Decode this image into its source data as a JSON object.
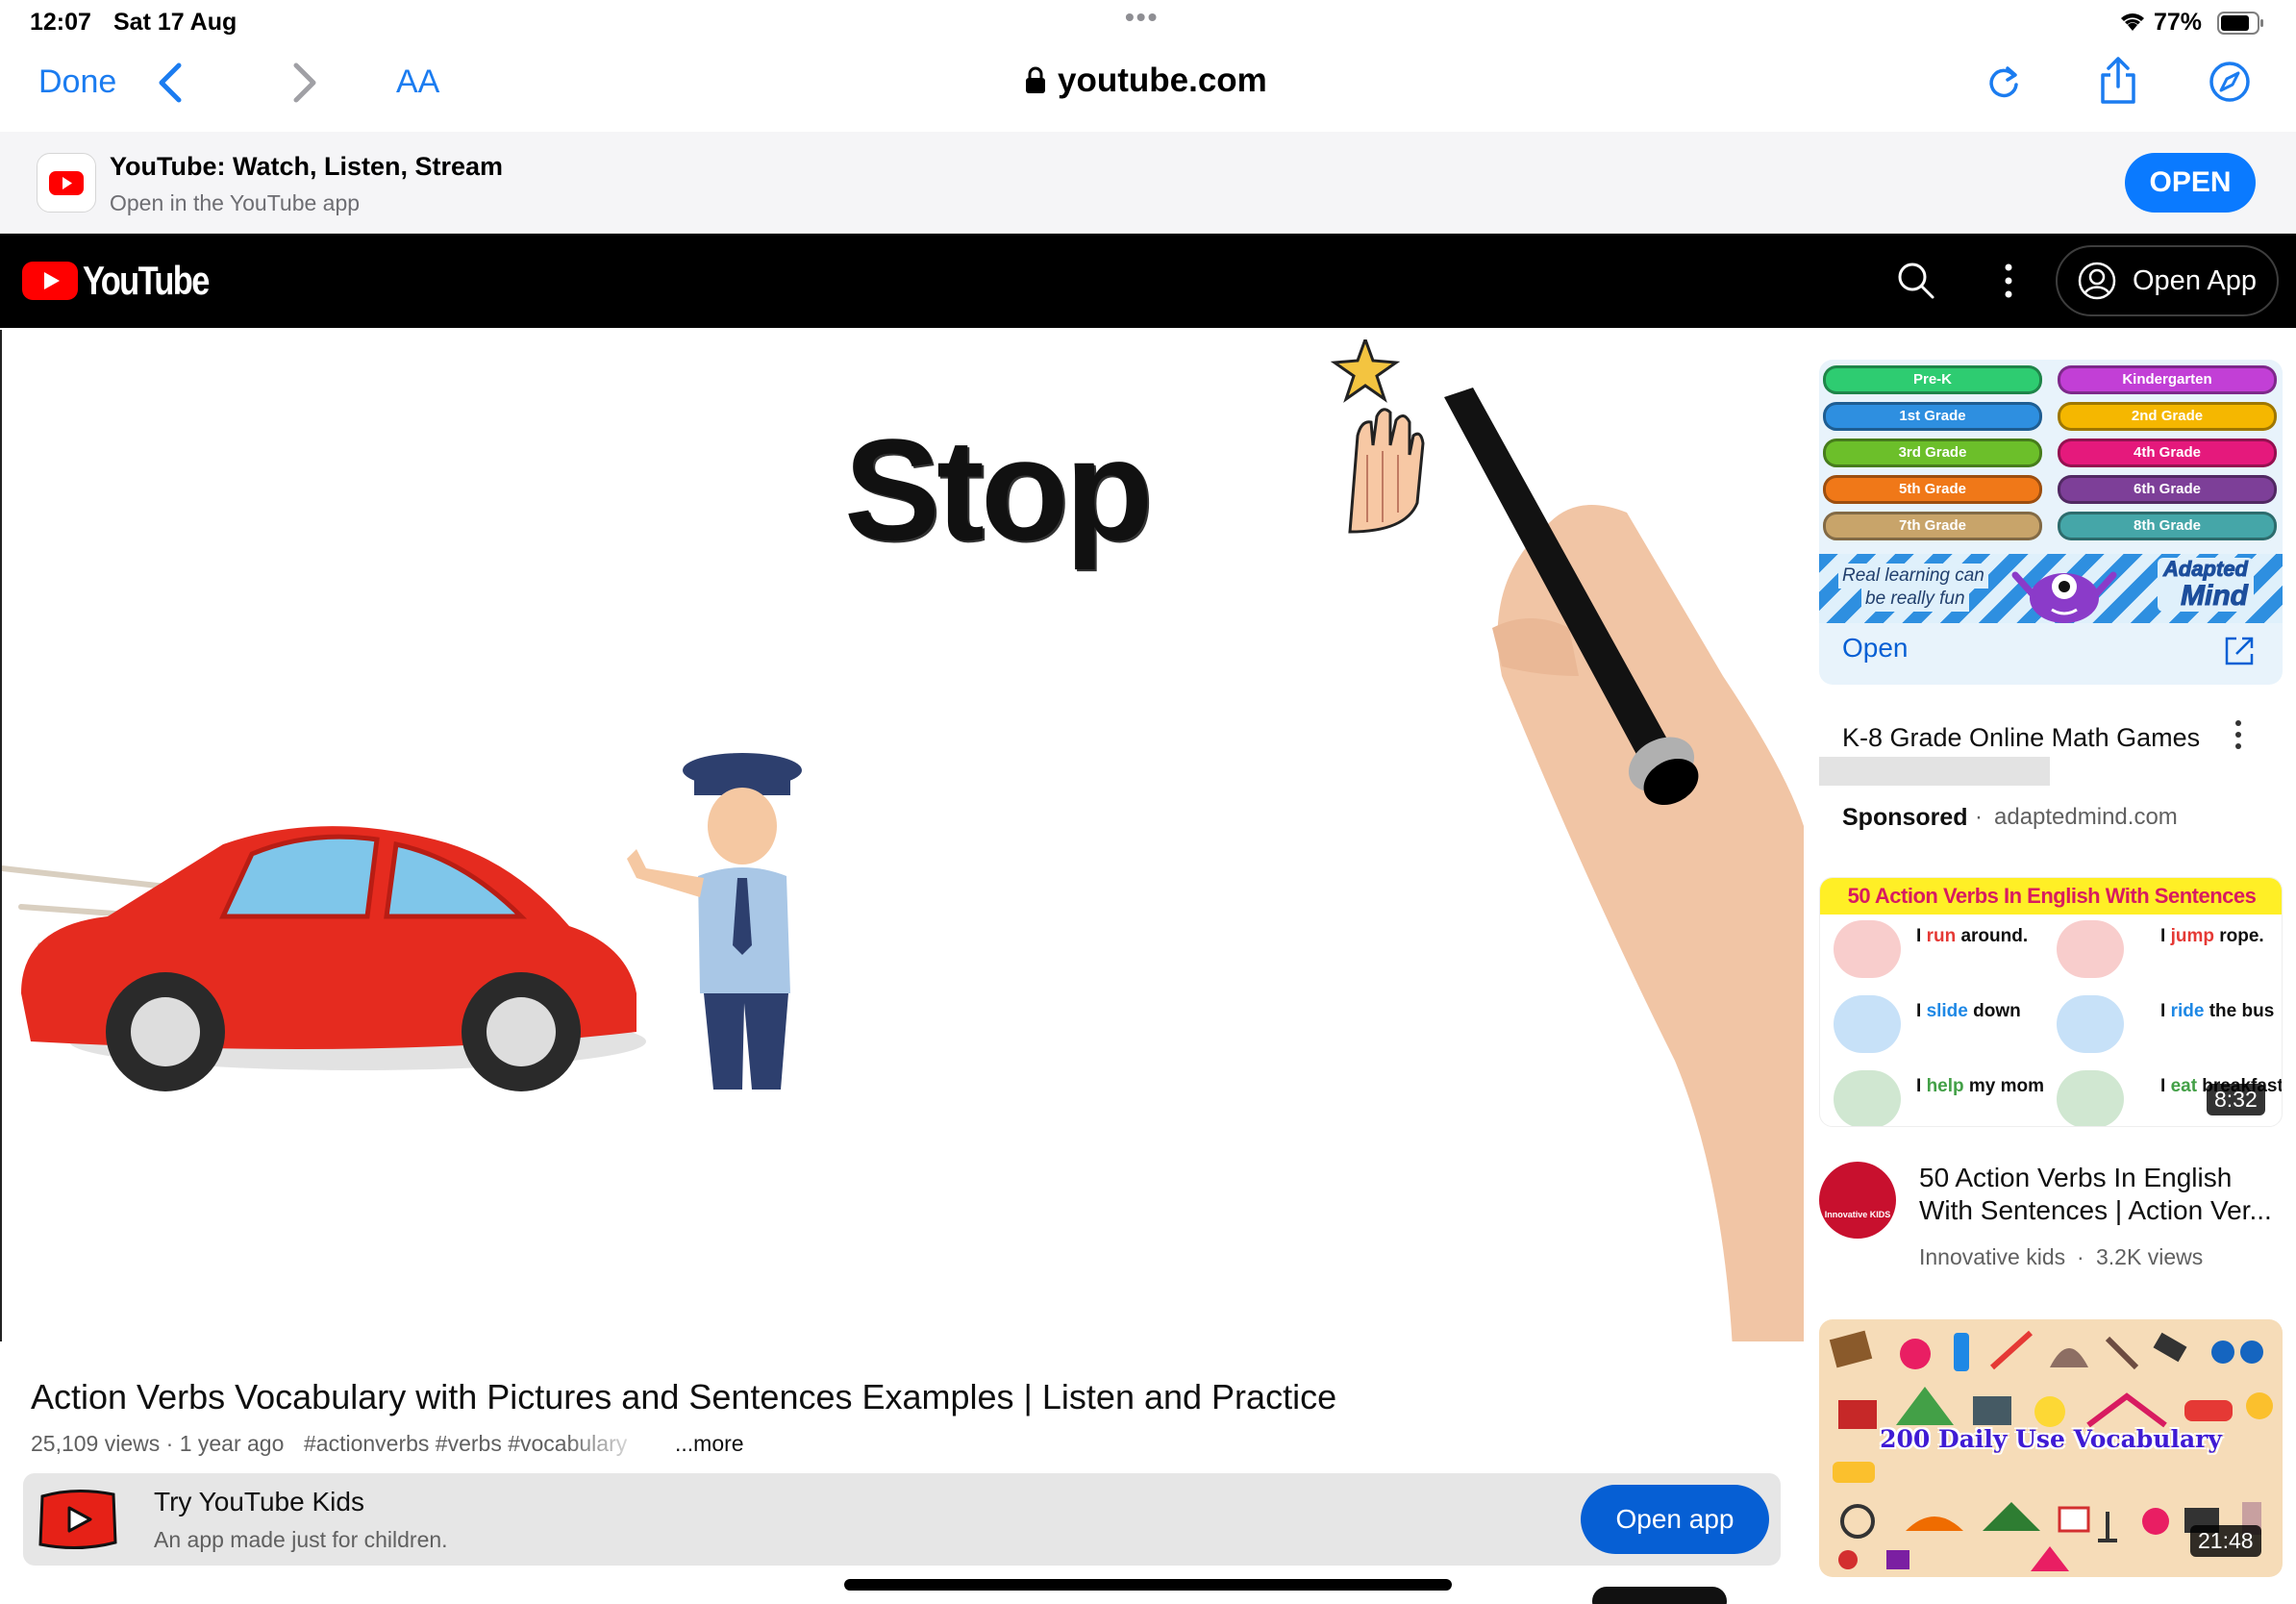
{
  "status_bar": {
    "time": "12:07",
    "date": "Sat 17 Aug",
    "dots": "•••",
    "battery": "77%"
  },
  "safari": {
    "done": "Done",
    "text_size": "AA",
    "url": "youtube.com"
  },
  "app_banner": {
    "title": "YouTube: Watch, Listen, Stream",
    "subtitle": "Open in the YouTube app",
    "open": "OPEN"
  },
  "yt_header": {
    "logo": "YouTube",
    "open_app": "Open App"
  },
  "video": {
    "frame_word": "Stop",
    "title": "Action Verbs Vocabulary with Pictures and Sentences Examples | Listen and Practice",
    "meta": "25,109 views · 1 year ago",
    "tags": "#actionverbs #verbs #vocabulary",
    "more": "...more"
  },
  "kids_promo": {
    "title": "Try YouTube Kids",
    "subtitle": "An app made just for children.",
    "button": "Open app"
  },
  "ad": {
    "grades": [
      {
        "label": "Pre-K",
        "color": "#2ecc71"
      },
      {
        "label": "Kindergarten",
        "color": "#c23fd6"
      },
      {
        "label": "1st Grade",
        "color": "#2e8fe0"
      },
      {
        "label": "2nd Grade",
        "color": "#f5b700"
      },
      {
        "label": "3rd Grade",
        "color": "#6cbf2a"
      },
      {
        "label": "4th Grade",
        "color": "#e5197c"
      },
      {
        "label": "5th Grade",
        "color": "#f07818"
      },
      {
        "label": "6th Grade",
        "color": "#7d3f98"
      },
      {
        "label": "7th Grade",
        "color": "#c8a46a"
      },
      {
        "label": "8th Grade",
        "color": "#45a6a8"
      }
    ],
    "tagline_1": "Real learning can",
    "tagline_2": "be really fun",
    "brand_1": "Adapted",
    "brand_2": "Mind",
    "open": "Open",
    "title": "K-8 Grade Online Math Games",
    "sponsored": "Sponsored",
    "domain": "adaptedmind.com"
  },
  "rec1": {
    "banner": "50 Action Verbs In English With Sentences",
    "lines": [
      {
        "pre": "I ",
        "verb": "run",
        "post": " around.",
        "color": "#e53935"
      },
      {
        "pre": "I ",
        "verb": "jump",
        "post": " rope.",
        "color": "#e53935"
      },
      {
        "pre": "I ",
        "verb": "slide",
        "post": " down",
        "color": "#1e88e5"
      },
      {
        "pre": "I ",
        "verb": "ride",
        "post": " the bus",
        "color": "#1e88e5"
      },
      {
        "pre": "I ",
        "verb": "help",
        "post": " my mom",
        "color": "#43a047"
      },
      {
        "pre": "I ",
        "verb": "eat",
        "post": " breakfast",
        "color": "#43a047"
      }
    ],
    "duration": "8:32",
    "title_1": "50 Action Verbs In English",
    "title_2": "With Sentences | Action Ver...",
    "channel": "Innovative kids",
    "views": "3.2K views",
    "avatar_text": "Innovative KIDS"
  },
  "rec2": {
    "banner": "200 Daily Use Vocabulary",
    "duration": "21:48"
  }
}
